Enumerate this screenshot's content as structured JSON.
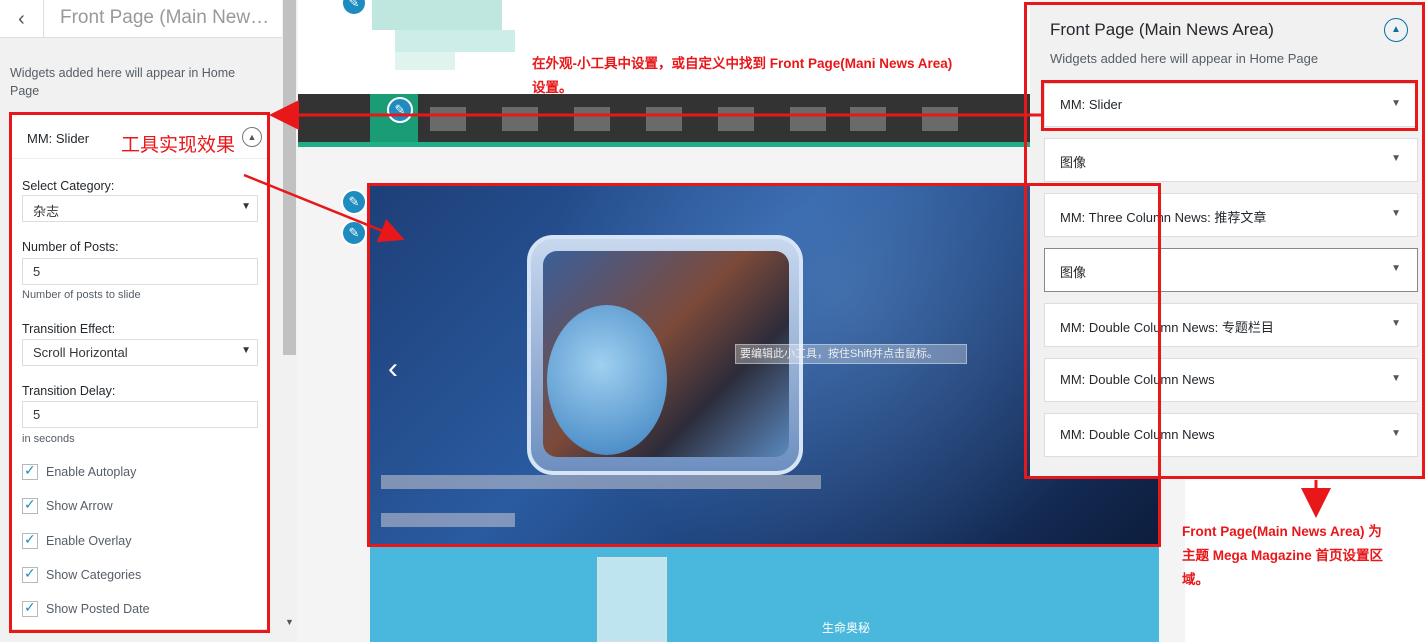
{
  "left_panel": {
    "title": "Front Page (Main News...",
    "description": "Widgets added here will appear in Home Page",
    "widget": {
      "title": "MM: Slider",
      "select_category": {
        "label": "Select Category:",
        "value": "杂志"
      },
      "number_of_posts": {
        "label": "Number of Posts:",
        "value": "5",
        "help": "Number of posts to slide"
      },
      "transition_effect": {
        "label": "Transition Effect:",
        "value": "Scroll Horizontal"
      },
      "transition_delay": {
        "label": "Transition Delay:",
        "value": "5",
        "help": "in seconds"
      },
      "checkboxes": [
        {
          "label": "Enable Autoplay",
          "checked": true
        },
        {
          "label": "Show Arrow",
          "checked": true
        },
        {
          "label": "Enable Overlay",
          "checked": true
        },
        {
          "label": "Show Categories",
          "checked": true
        },
        {
          "label": "Show Posted Date",
          "checked": true
        }
      ]
    }
  },
  "preview": {
    "slider_tooltip": "要编辑此小工具，按住Shift并点击鼠标。",
    "lower_text": "生命奥秘"
  },
  "annotations": {
    "effect_label": "工具实现效果",
    "top_note_line1": "在外观-小工具中设置，或自定义中找到 Front Page(Mani News Area)",
    "top_note_line2": "设置。",
    "bottom_note_line1": "Front Page(Main News Area) 为",
    "bottom_note_line2": "主题 Mega Magazine 首页设置区",
    "bottom_note_line3": "域。"
  },
  "right_panel": {
    "title": "Front Page (Main News Area)",
    "description": "Widgets added here will appear in Home Page",
    "widgets": [
      "MM: Slider",
      "图像",
      "MM: Three Column News: 推荐文章",
      "图像",
      "MM: Double Column News: 专题栏目",
      "MM: Double Column News",
      "MM: Double Column News"
    ]
  },
  "colors": {
    "highlight_red": "#e8171a",
    "accent_blue": "#1e8cbe",
    "nav_green": "#1a9c77"
  }
}
